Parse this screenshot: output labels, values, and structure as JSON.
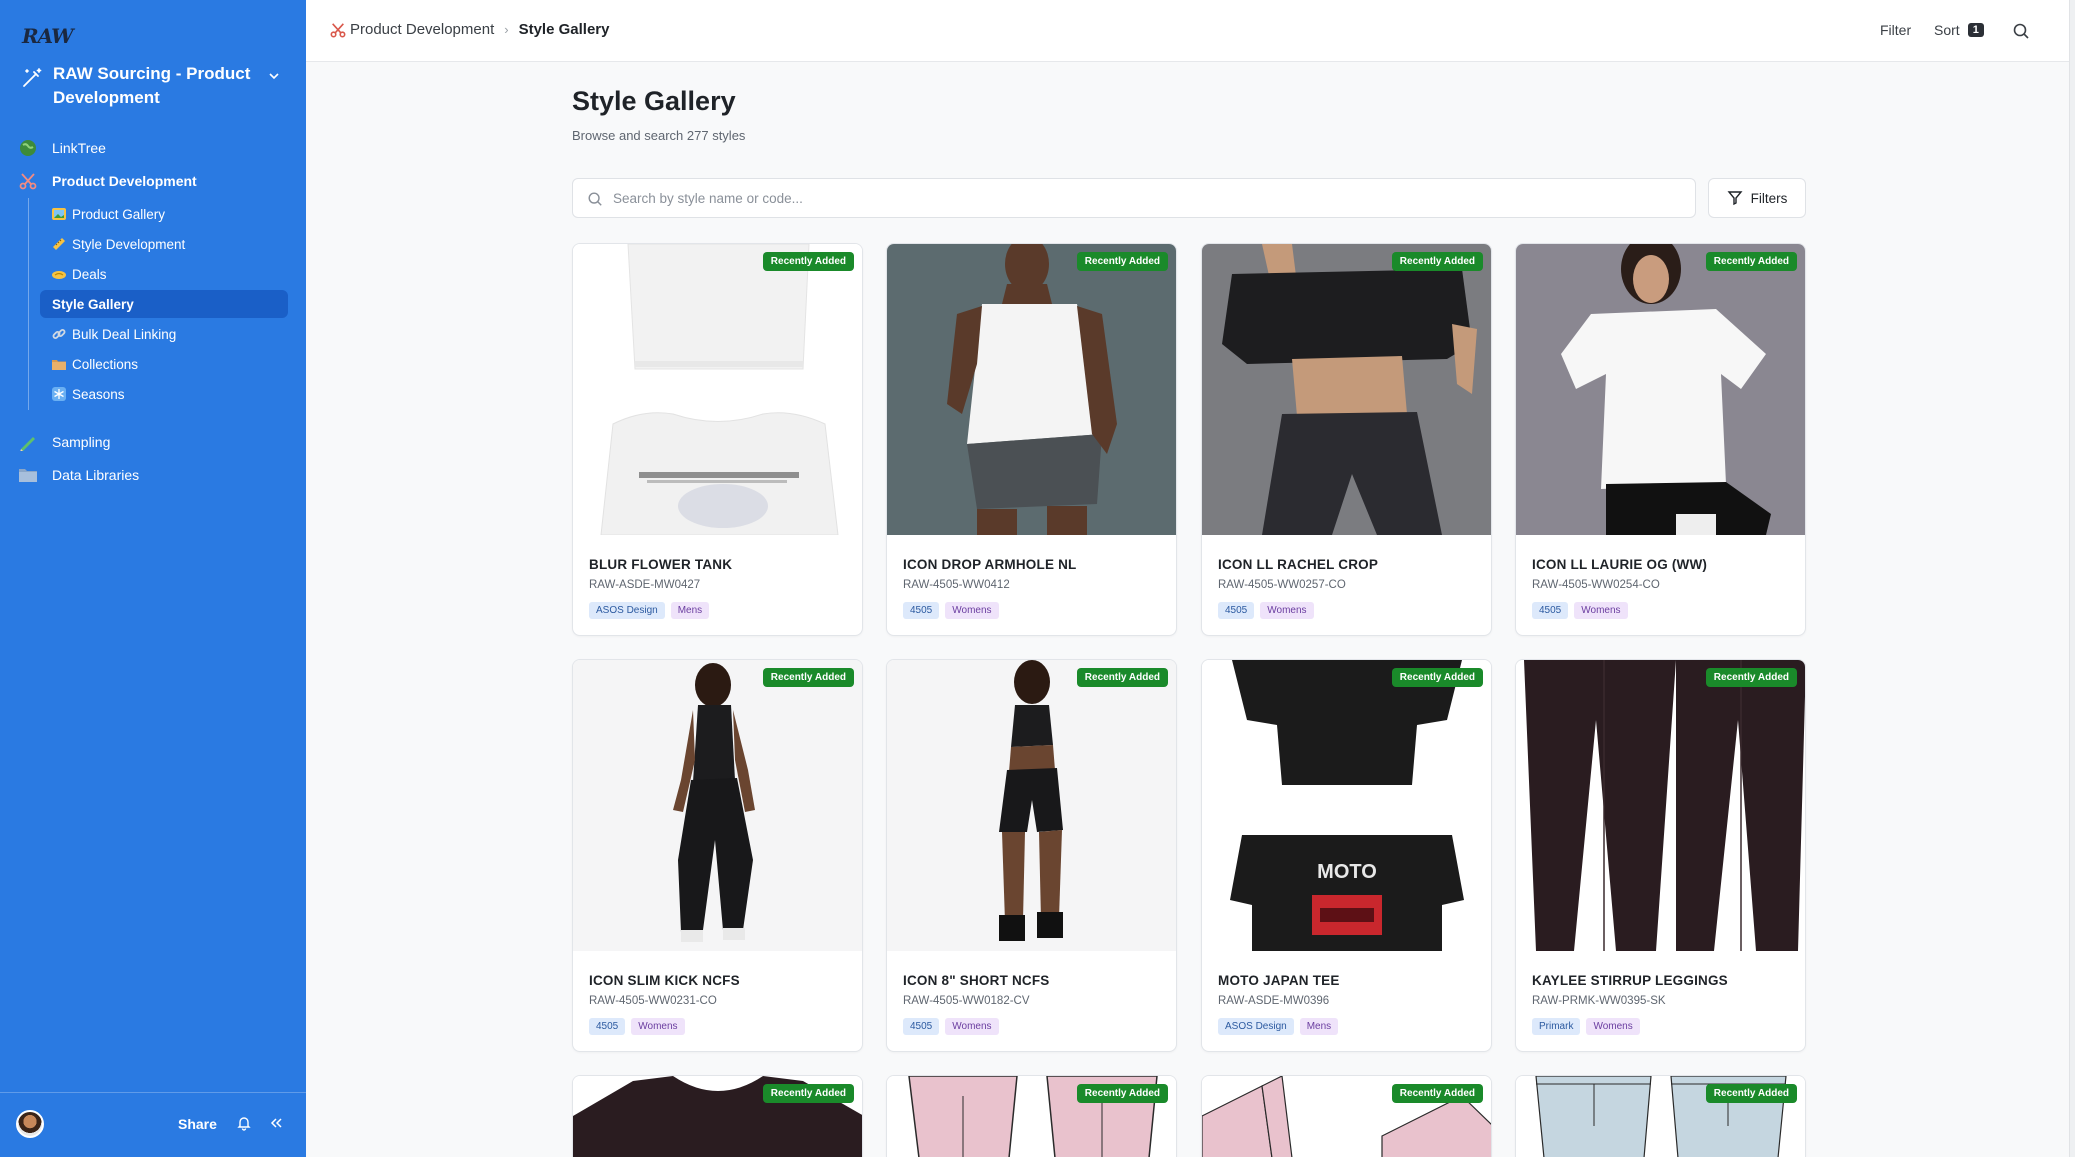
{
  "sidebar": {
    "logo": "RAW",
    "workspace_title": "RAW Sourcing - Product Development",
    "nav_top": [
      {
        "label": "LinkTree",
        "icon": "globe-icon"
      },
      {
        "label": "Product Development",
        "icon": "scissors-icon"
      }
    ],
    "nav_sub": [
      {
        "label": "Product Gallery",
        "icon": "picture-icon"
      },
      {
        "label": "Style Development",
        "icon": "ruler-icon"
      },
      {
        "label": "Deals",
        "icon": "handshake-icon"
      },
      {
        "label": "Style Gallery",
        "icon": "",
        "active": true
      },
      {
        "label": "Bulk Deal Linking",
        "icon": "link-icon"
      },
      {
        "label": "Collections",
        "icon": "folder-icon"
      },
      {
        "label": "Seasons",
        "icon": "snowflake-icon"
      }
    ],
    "nav_bottom": [
      {
        "label": "Sampling",
        "icon": "pencil-icon"
      },
      {
        "label": "Data Libraries",
        "icon": "folder-icon"
      }
    ],
    "share_label": "Share"
  },
  "topbar": {
    "breadcrumb": [
      "Product Development",
      "Style Gallery"
    ],
    "filter_label": "Filter",
    "sort_label": "Sort",
    "sort_count": "1"
  },
  "main": {
    "title": "Style Gallery",
    "subtitle": "Browse and search 277 styles",
    "search_placeholder": "Search by style name or code...",
    "filters_label": "Filters"
  },
  "badge_label": "Recently Added",
  "cards": [
    {
      "name": "BLUR FLOWER TANK",
      "code": "RAW-ASDE-MW0427",
      "brand": "ASOS Design",
      "gender": "Mens"
    },
    {
      "name": "ICON DROP ARMHOLE NL",
      "code": "RAW-4505-WW0412",
      "brand": "4505",
      "gender": "Womens"
    },
    {
      "name": "ICON LL RACHEL CROP",
      "code": "RAW-4505-WW0257-CO",
      "brand": "4505",
      "gender": "Womens"
    },
    {
      "name": "ICON LL LAURIE OG (WW)",
      "code": "RAW-4505-WW0254-CO",
      "brand": "4505",
      "gender": "Womens"
    },
    {
      "name": "ICON SLIM KICK NCFS",
      "code": "RAW-4505-WW0231-CO",
      "brand": "4505",
      "gender": "Womens"
    },
    {
      "name": "ICON 8\" SHORT NCFS",
      "code": "RAW-4505-WW0182-CV",
      "brand": "4505",
      "gender": "Womens"
    },
    {
      "name": "MOTO JAPAN TEE",
      "code": "RAW-ASDE-MW0396",
      "brand": "ASOS Design",
      "gender": "Mens",
      "print_text": "MOTO"
    },
    {
      "name": "KAYLEE STIRRUP LEGGINGS",
      "code": "RAW-PRMK-WW0395-SK",
      "brand": "Primark",
      "gender": "Womens"
    }
  ]
}
